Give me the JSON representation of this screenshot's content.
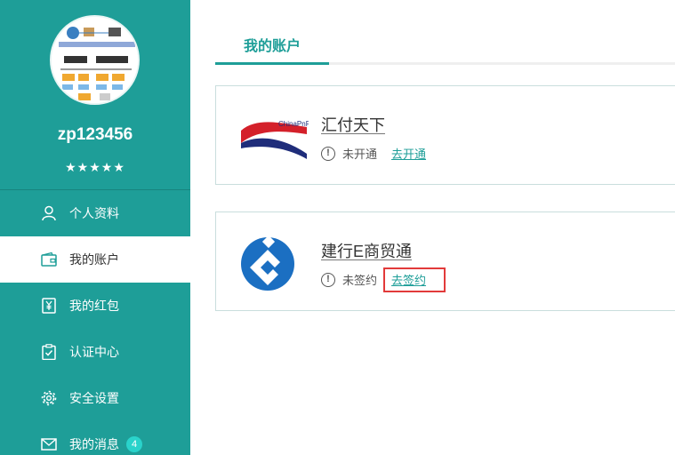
{
  "user": {
    "username": "zp123456",
    "rating_stars": "★★★★★"
  },
  "sidebar": {
    "items": [
      {
        "label": "个人资料",
        "icon": "person-icon"
      },
      {
        "label": "我的账户",
        "icon": "wallet-icon",
        "active": true
      },
      {
        "label": "我的红包",
        "icon": "yen-envelope-icon"
      },
      {
        "label": "认证中心",
        "icon": "clipboard-check-icon"
      },
      {
        "label": "安全设置",
        "icon": "gear-icon"
      },
      {
        "label": "我的消息",
        "icon": "mail-icon",
        "badge": "4"
      }
    ]
  },
  "main": {
    "tab_label": "我的账户",
    "accounts": [
      {
        "name": "汇付天下",
        "logo_text": "ChinaPnR",
        "info_glyph": "!",
        "status": "未开通",
        "action": "去开通"
      },
      {
        "name": "建行E商贸通",
        "info_glyph": "!",
        "status": "未签约",
        "action": "去签约"
      }
    ]
  },
  "colors": {
    "accent": "#1e9e98",
    "highlight_border": "#e23a3a",
    "badge": "#2ad3cb"
  }
}
